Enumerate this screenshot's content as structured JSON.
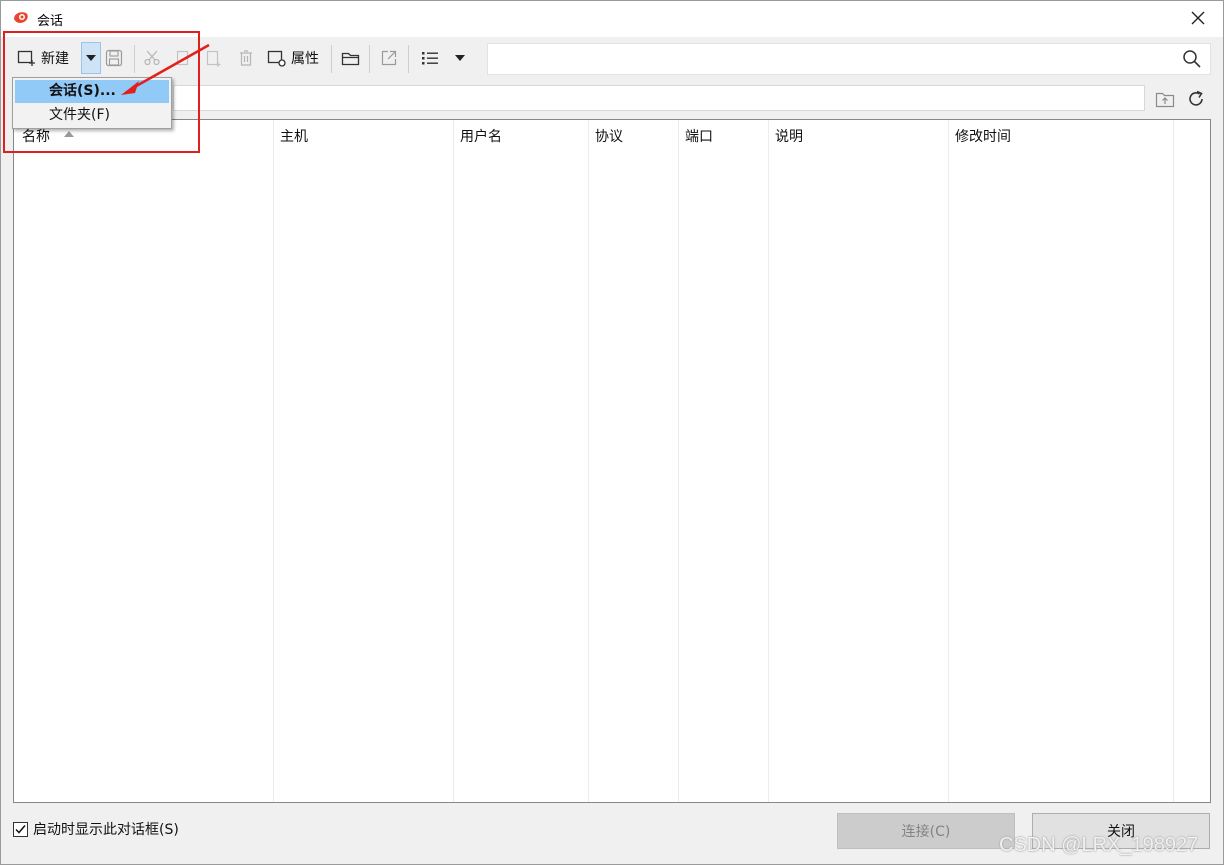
{
  "window": {
    "title": "会话"
  },
  "toolbar": {
    "new_label": "新建",
    "properties_label": "属性",
    "search_value": ""
  },
  "dropdown": {
    "items": [
      {
        "label": "会话(S)..."
      },
      {
        "label": "文件夹(F)"
      }
    ]
  },
  "table": {
    "columns": [
      "名称",
      "主机",
      "用户名",
      "协议",
      "端口",
      "说明",
      "修改时间"
    ],
    "rows": []
  },
  "footer": {
    "show_on_startup_label": "启动时显示此对话框(S)",
    "show_on_startup_checked": true,
    "connect_label": "连接(C)",
    "close_label": "关闭"
  },
  "watermark": "CSDN @LRX_198927",
  "colors": {
    "accent_selection": "#91c9f7",
    "annotation_red": "#e0201c"
  }
}
